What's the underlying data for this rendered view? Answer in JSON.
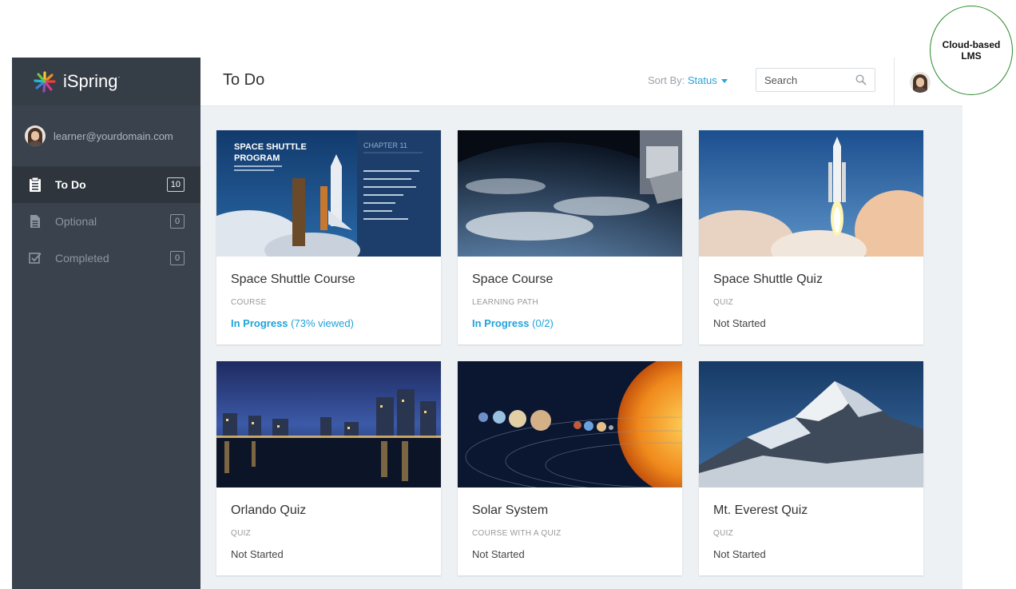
{
  "brand": {
    "name": "iSpring"
  },
  "user": {
    "email": "learner@yourdomain.com"
  },
  "nav": [
    {
      "label": "To Do",
      "count": "10",
      "icon": "clipboard-icon",
      "active": true
    },
    {
      "label": "Optional",
      "count": "0",
      "icon": "document-icon",
      "active": false
    },
    {
      "label": "Completed",
      "count": "0",
      "icon": "checkbox-icon",
      "active": false
    }
  ],
  "header": {
    "title": "To Do",
    "sort_label": "Sort By:",
    "sort_value": "Status",
    "search_placeholder": "Search"
  },
  "cards": [
    {
      "title": "Space Shuttle Course",
      "type": "COURSE",
      "status": "In Progress",
      "status_detail": "(73% viewed)",
      "image": "space-shuttle-program-slide",
      "in_progress": true
    },
    {
      "title": "Space Course",
      "type": "LEARNING PATH",
      "status": "In Progress",
      "status_detail": "(0/2)",
      "image": "earth-from-orbit",
      "in_progress": true
    },
    {
      "title": "Space Shuttle Quiz",
      "type": "QUIZ",
      "status": "Not Started",
      "status_detail": "",
      "image": "shuttle-launch",
      "in_progress": false
    },
    {
      "title": "Orlando Quiz",
      "type": "QUIZ",
      "status": "Not Started",
      "status_detail": "",
      "image": "orlando-skyline-night",
      "in_progress": false
    },
    {
      "title": "Solar System",
      "type": "COURSE WITH A QUIZ",
      "status": "Not Started",
      "status_detail": "",
      "image": "solar-system-planets",
      "in_progress": false
    },
    {
      "title": "Mt. Everest Quiz",
      "type": "QUIZ",
      "status": "Not Started",
      "status_detail": "",
      "image": "mountain-peak",
      "in_progress": false
    }
  ],
  "slide_thumb": {
    "title_line1": "SPACE SHUTTLE",
    "title_line2": "PROGRAM",
    "chapter": "CHAPTER 11"
  },
  "badge": {
    "line1": "Cloud-based",
    "line2": "LMS"
  },
  "colors": {
    "accent": "#1fa3da",
    "sidebar": "#3a434d",
    "badge_border": "#2a8a2a"
  }
}
